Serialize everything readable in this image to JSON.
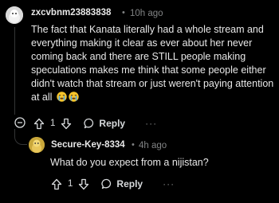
{
  "comments": [
    {
      "author": "zxcvbnm23883838",
      "separator": "•",
      "time": "10h ago",
      "body": "The fact that Kanata literally had a whole stream and everything making it clear as ever about her never coming back and there are STILL people making speculations makes me think that some people either didn't watch that stream or just weren't paying attention at all",
      "votes": "1",
      "reply_label": "Reply",
      "more_label": "···",
      "emojis": [
        "loudly-crying-face",
        "loudly-crying-face"
      ]
    },
    {
      "author": "Secure-Key-8334",
      "separator": "•",
      "time": "4h ago",
      "body": "What do you expect from a nijistan?",
      "votes": "1",
      "reply_label": "Reply",
      "more_label": "···"
    }
  ],
  "colors": {
    "background": "#000000",
    "text": "#e8e8e8",
    "muted": "#818384",
    "thread_line": "#343536",
    "avatar2": "#c9a73a"
  }
}
